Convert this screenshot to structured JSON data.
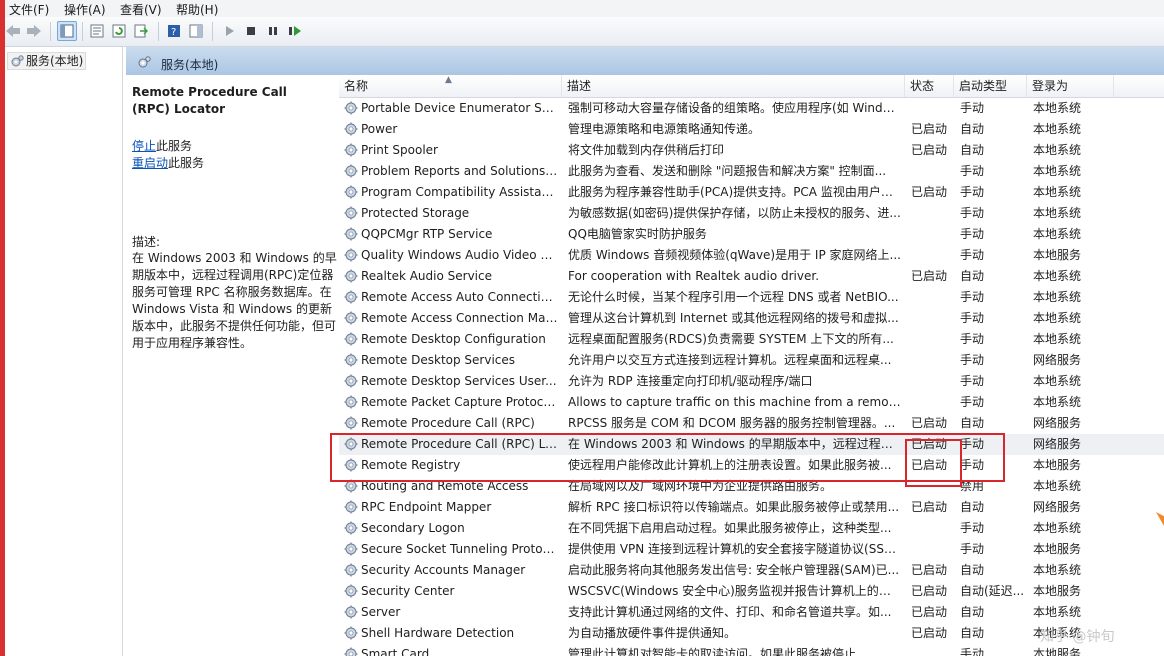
{
  "menu": [
    "文件(F)",
    "操作(A)",
    "查看(V)",
    "帮助(H)"
  ],
  "tree": {
    "root_label": "服务(本地)"
  },
  "header": {
    "title": "服务(本地)"
  },
  "detail": {
    "service_title": "Remote Procedure Call (RPC) Locator",
    "stop_link": "停止",
    "stop_suffix": "此服务",
    "restart_link": "重启动",
    "restart_suffix": "此服务",
    "description_label": "描述:",
    "description_text": "在 Windows 2003 和 Windows 的早期版本中，远程过程调用(RPC)定位器服务可管理 RPC 名称服务数据库。在 Windows Vista 和 Windows 的更新版本中，此服务不提供任何功能，但可用于应用程序兼容性。"
  },
  "columns": {
    "name": "名称",
    "description": "描述",
    "status": "状态",
    "startup": "启动类型",
    "logon": "登录为"
  },
  "services": [
    {
      "name": "Portable Device Enumerator Ser...",
      "desc": "强制可移动大容量存储设备的组策略。使应用程序(如 Windo...",
      "status": "",
      "startup": "手动",
      "logon": "本地系统"
    },
    {
      "name": "Power",
      "desc": "管理电源策略和电源策略通知传递。",
      "status": "已启动",
      "startup": "自动",
      "logon": "本地系统"
    },
    {
      "name": "Print Spooler",
      "desc": "将文件加载到内存供稍后打印",
      "status": "已启动",
      "startup": "自动",
      "logon": "本地系统"
    },
    {
      "name": "Problem Reports and Solutions ...",
      "desc": "此服务为查看、发送和删除 \"问题报告和解决方案\" 控制面...",
      "status": "",
      "startup": "手动",
      "logon": "本地系统"
    },
    {
      "name": "Program Compatibility Assistant ...",
      "desc": "此服务为程序兼容性助手(PCA)提供支持。PCA 监视由用户安...",
      "status": "已启动",
      "startup": "手动",
      "logon": "本地系统"
    },
    {
      "name": "Protected Storage",
      "desc": "为敏感数据(如密码)提供保护存储，以防止未授权的服务、进...",
      "status": "",
      "startup": "手动",
      "logon": "本地系统"
    },
    {
      "name": "QQPCMgr RTP Service",
      "desc": "QQ电脑管家实时防护服务",
      "status": "",
      "startup": "手动",
      "logon": "本地系统"
    },
    {
      "name": "Quality Windows Audio Video Ex...",
      "desc": "优质 Windows 音频视频体验(qWave)是用于 IP 家庭网络上...",
      "status": "",
      "startup": "手动",
      "logon": "本地服务"
    },
    {
      "name": "Realtek Audio Service",
      "desc": "For cooperation with Realtek audio driver.",
      "status": "已启动",
      "startup": "自动",
      "logon": "本地系统"
    },
    {
      "name": "Remote Access Auto Connection...",
      "desc": "无论什么时候，当某个程序引用一个远程 DNS 或者 NetBIO...",
      "status": "",
      "startup": "手动",
      "logon": "本地系统"
    },
    {
      "name": "Remote Access Connection Man...",
      "desc": "管理从这台计算机到 Internet 或其他远程网络的拨号和虚拟...",
      "status": "",
      "startup": "手动",
      "logon": "本地系统"
    },
    {
      "name": "Remote Desktop Configuration",
      "desc": "远程桌面配置服务(RDCS)负责需要 SYSTEM 上下文的所有...",
      "status": "",
      "startup": "手动",
      "logon": "本地系统"
    },
    {
      "name": "Remote Desktop Services",
      "desc": "允许用户以交互方式连接到远程计算机。远程桌面和远程桌...",
      "status": "",
      "startup": "手动",
      "logon": "网络服务"
    },
    {
      "name": "Remote Desktop Services User...",
      "desc": "允许为 RDP 连接重定向打印机/驱动程序/端口",
      "status": "",
      "startup": "手动",
      "logon": "本地系统"
    },
    {
      "name": "Remote Packet Capture Protocol...",
      "desc": "Allows to capture traffic on this machine from a remote...",
      "status": "",
      "startup": "手动",
      "logon": "本地系统"
    },
    {
      "name": "Remote Procedure Call (RPC)",
      "desc": "RPCSS 服务是 COM 和 DCOM 服务器的服务控制管理器。...",
      "status": "已启动",
      "startup": "自动",
      "logon": "网络服务"
    },
    {
      "name": "Remote Procedure Call (RPC) Lo...",
      "desc": "在 Windows 2003 和 Windows 的早期版本中，远程过程调...",
      "status": "已启动",
      "startup": "手动",
      "logon": "网络服务"
    },
    {
      "name": "Remote Registry",
      "desc": "使远程用户能修改此计算机上的注册表设置。如果此服务被...",
      "status": "已启动",
      "startup": "手动",
      "logon": "本地服务"
    },
    {
      "name": "Routing and Remote Access",
      "desc": "在局域网以及广域网环境中为企业提供路由服务。",
      "status": "",
      "startup": "禁用",
      "logon": "本地系统"
    },
    {
      "name": "RPC Endpoint Mapper",
      "desc": "解析 RPC 接口标识符以传输端点。如果此服务被停止或禁用...",
      "status": "已启动",
      "startup": "自动",
      "logon": "网络服务"
    },
    {
      "name": "Secondary Logon",
      "desc": "在不同凭据下启用启动过程。如果此服务被停止，这种类型...",
      "status": "",
      "startup": "手动",
      "logon": "本地系统"
    },
    {
      "name": "Secure Socket Tunneling Protoc...",
      "desc": "提供使用 VPN 连接到远程计算机的安全套接字隧道协议(SST...",
      "status": "",
      "startup": "手动",
      "logon": "本地服务"
    },
    {
      "name": "Security Accounts Manager",
      "desc": "启动此服务将向其他服务发出信号: 安全帐户管理器(SAM)已...",
      "status": "已启动",
      "startup": "自动",
      "logon": "本地系统"
    },
    {
      "name": "Security Center",
      "desc": "WSCSVC(Windows 安全中心)服务监视并报告计算机上的安...",
      "status": "已启动",
      "startup": "自动(延迟...",
      "logon": "本地服务"
    },
    {
      "name": "Server",
      "desc": "支持此计算机通过网络的文件、打印、和命名管道共享。如...",
      "status": "已启动",
      "startup": "自动",
      "logon": "本地系统"
    },
    {
      "name": "Shell Hardware Detection",
      "desc": "为自动播放硬件事件提供通知。",
      "status": "已启动",
      "startup": "自动",
      "logon": "本地系统"
    },
    {
      "name": "Smart Card",
      "desc": "管理此计算机对智能卡的取读访问。如果此服务被停止...",
      "status": "",
      "startup": "手动",
      "logon": "本地服务"
    }
  ],
  "watermark": "知乎 @钟旬"
}
